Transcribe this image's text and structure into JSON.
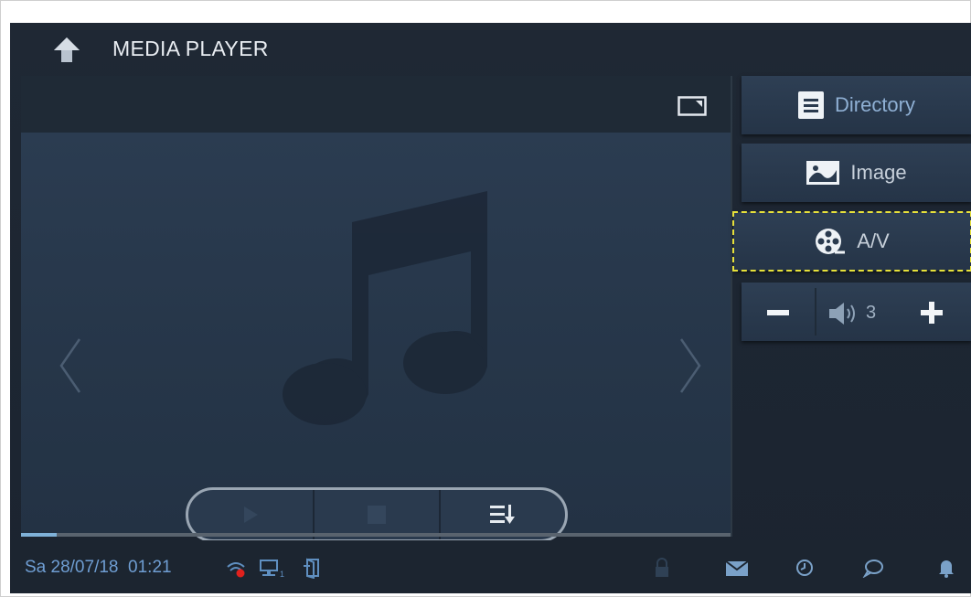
{
  "header": {
    "title": "MEDIA PLAYER",
    "back_icon": "back-arrow-icon"
  },
  "player": {
    "fullscreen_icon": "fullscreen-toggle-icon",
    "placeholder_icon": "music-note-icon",
    "progress_fraction": 0.05,
    "controls": [
      {
        "name": "play",
        "icon": "play-icon"
      },
      {
        "name": "stop",
        "icon": "stop-icon"
      },
      {
        "name": "playlist",
        "icon": "playlist-sort-icon"
      }
    ]
  },
  "sidebar": {
    "directory_label": "Directory",
    "image_label": "Image",
    "av_label": "A/V"
  },
  "volume": {
    "level": "3",
    "minus_icon": "minus-icon",
    "plus_icon": "plus-icon",
    "speaker_icon": "speaker-icon"
  },
  "status": {
    "date": "Sa 28/07/18",
    "time": "01:21",
    "network_sub": "1",
    "icons": [
      "wifi-icon",
      "network-icon",
      "door-icon",
      "lock-icon",
      "mail-icon",
      "history-icon",
      "message-icon",
      "bell-icon"
    ]
  },
  "colors": {
    "background": "#1f2834",
    "accent_blue": "#7fb1d8",
    "focus_outline": "#e7e13a",
    "alert_red": "#e0211d"
  }
}
